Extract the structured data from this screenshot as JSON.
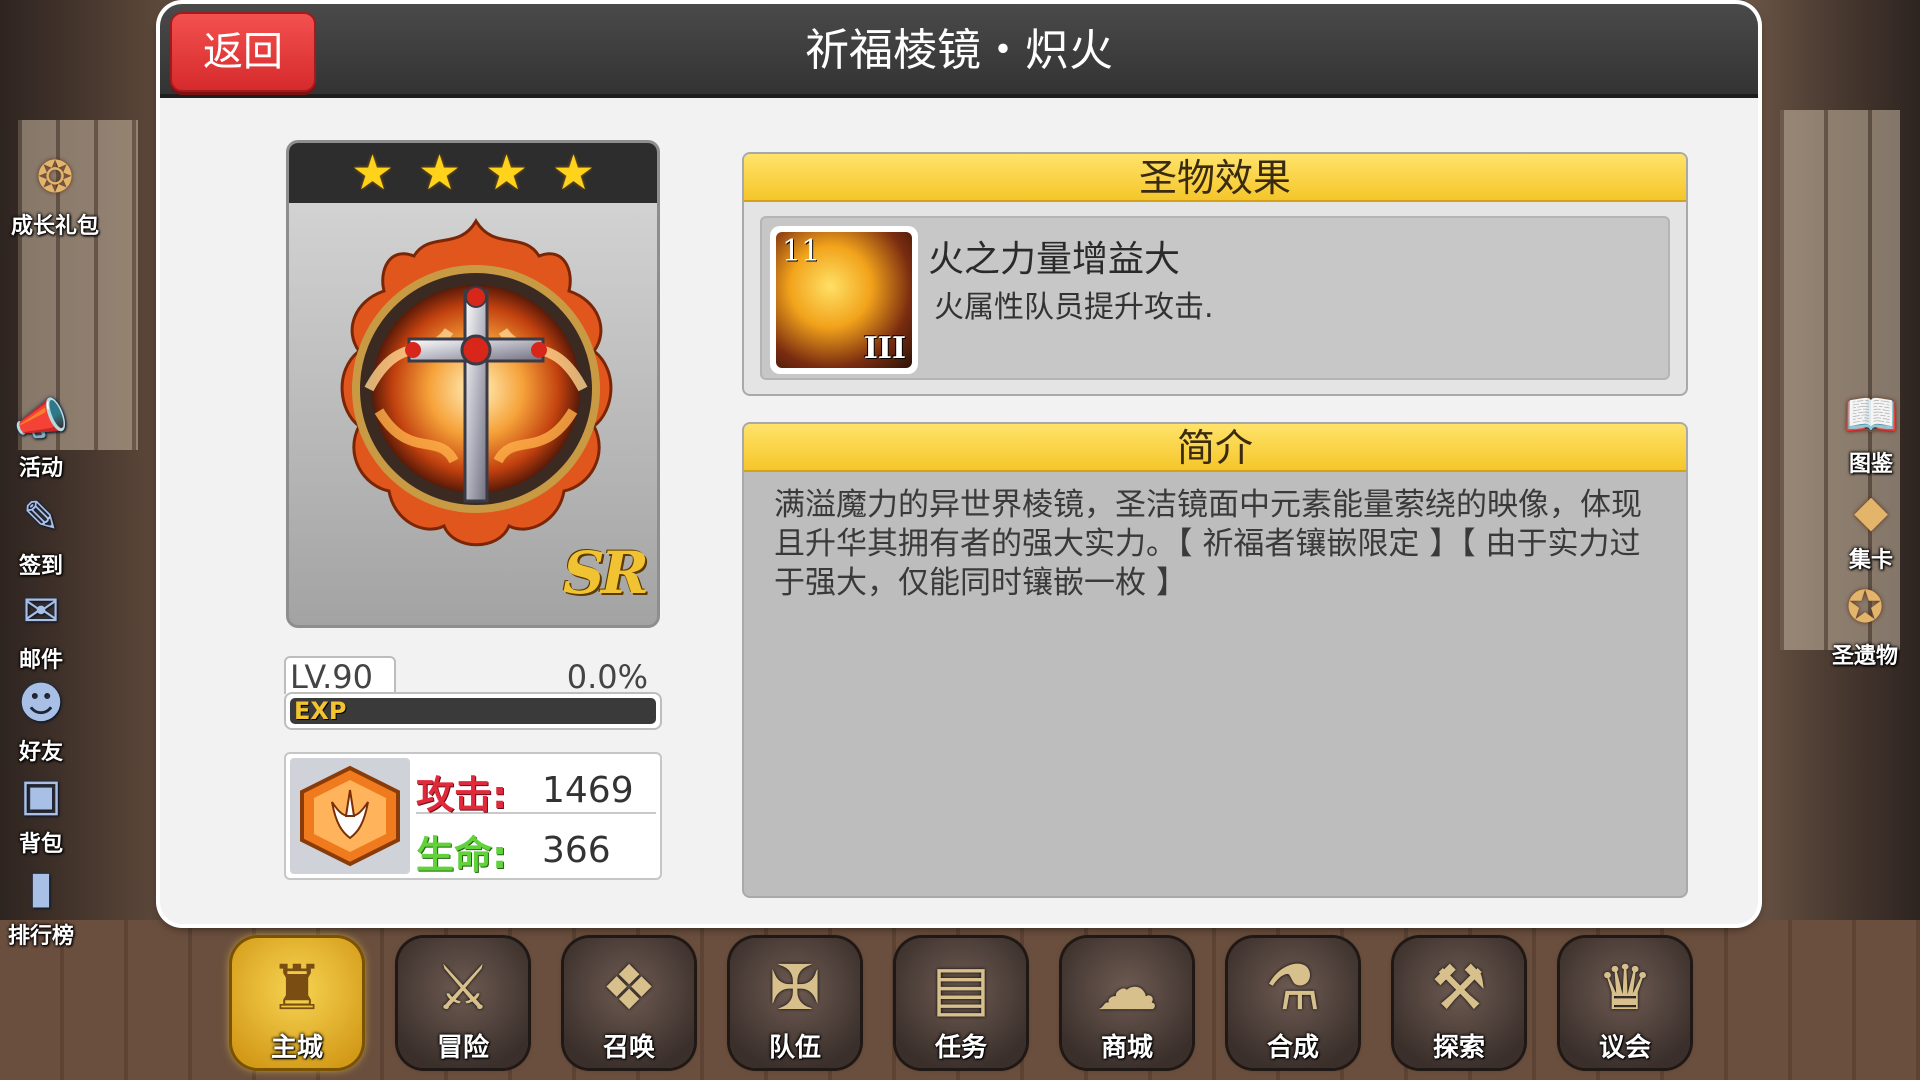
{
  "header": {
    "title": "祈福棱镜・炽火",
    "back_label": "返回"
  },
  "left_menu": [
    {
      "label": "成长礼包",
      "icon": "gift-pack-icon"
    },
    {
      "label": "活动",
      "icon": "megaphone-icon"
    },
    {
      "label": "签到",
      "icon": "checkin-board-icon"
    },
    {
      "label": "邮件",
      "icon": "mail-icon"
    },
    {
      "label": "好友",
      "icon": "friends-icon"
    },
    {
      "label": "背包",
      "icon": "backpack-icon"
    },
    {
      "label": "排行榜",
      "icon": "ranking-icon"
    }
  ],
  "right_menu": [
    {
      "label": "图鉴",
      "icon": "book-icon"
    },
    {
      "label": "集卡",
      "icon": "card-collection-icon"
    },
    {
      "label": "圣遗物",
      "icon": "relic-icon"
    }
  ],
  "relic": {
    "stars": 4,
    "rarity": "SR",
    "level_label": "LV.90",
    "exp_percent_label": "0.0%",
    "exp_fraction": 0.0,
    "exp_label": "EXP",
    "stats": {
      "attack_label": "攻击:",
      "attack_value": "1469",
      "hp_label": "生命:",
      "hp_value": "366"
    }
  },
  "effect_section": {
    "heading": "圣物效果",
    "skill_level_mark": "11",
    "skill_roman": "III",
    "name": "火之力量增益大",
    "description": "火属性队员提升攻击."
  },
  "intro_section": {
    "heading": "简介",
    "text": "满溢魔力的异世界棱镜，圣洁镜面中元素能量萦绕的映像，体现且升华其拥有者的强大实力。【 祈福者镶嵌限定 】【 由于实力过于强大，仅能同时镶嵌一枚 】"
  },
  "bottom_nav": [
    {
      "label": "主城",
      "icon": "castle-icon",
      "active": true
    },
    {
      "label": "冒险",
      "icon": "crossed-swords-icon",
      "active": false
    },
    {
      "label": "召唤",
      "icon": "summon-card-icon",
      "active": false
    },
    {
      "label": "队伍",
      "icon": "team-crest-icon",
      "active": false
    },
    {
      "label": "任务",
      "icon": "quest-book-icon",
      "active": false
    },
    {
      "label": "商城",
      "icon": "shop-icon",
      "active": false
    },
    {
      "label": "合成",
      "icon": "potion-icon",
      "active": false
    },
    {
      "label": "探索",
      "icon": "shovel-icon",
      "active": false
    },
    {
      "label": "议会",
      "icon": "council-crown-icon",
      "active": false
    }
  ],
  "colors": {
    "accent_yellow": "#f5c62a",
    "back_red": "#e03a3c",
    "attack_red": "#e02a3c",
    "hp_green": "#61d23c"
  }
}
